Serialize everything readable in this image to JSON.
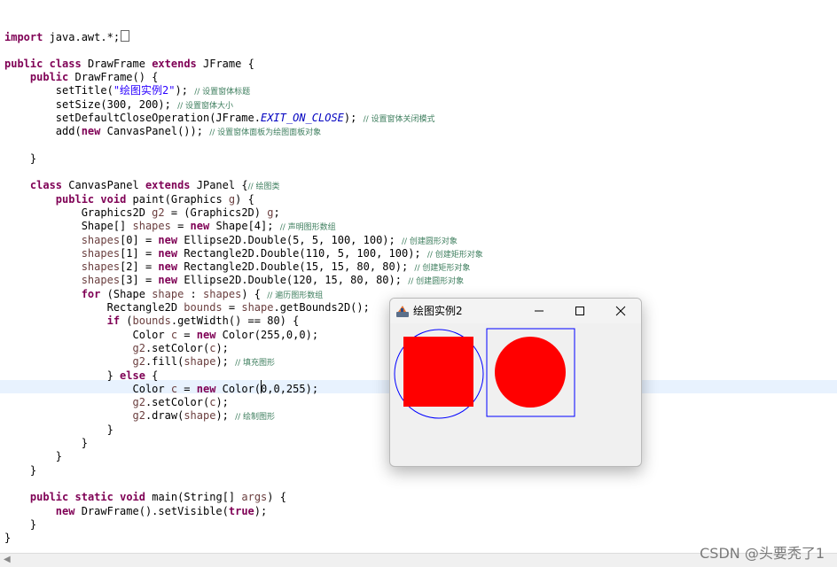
{
  "editor": {
    "lines": [
      {
        "parts": [
          {
            "t": "import",
            "c": "kw"
          },
          {
            "t": " java.awt.*;"
          }
        ],
        "glyph": true
      },
      {
        "parts": []
      },
      {
        "parts": [
          {
            "t": "public",
            "c": "kw"
          },
          {
            "t": " "
          },
          {
            "t": "class",
            "c": "kw"
          },
          {
            "t": " DrawFrame "
          },
          {
            "t": "extends",
            "c": "kw"
          },
          {
            "t": " JFrame {"
          }
        ]
      },
      {
        "parts": [
          {
            "t": "    "
          },
          {
            "t": "public",
            "c": "kw"
          },
          {
            "t": " DrawFrame() {"
          }
        ]
      },
      {
        "parts": [
          {
            "t": "        setTitle("
          },
          {
            "t": "\"绘图实例2\"",
            "c": "str"
          },
          {
            "t": "); "
          },
          {
            "t": "// 设置窗体标题",
            "c": "cm"
          }
        ]
      },
      {
        "parts": [
          {
            "t": "        setSize(300, 200); "
          },
          {
            "t": "// 设置窗体大小",
            "c": "cm"
          }
        ]
      },
      {
        "parts": [
          {
            "t": "        setDefaultCloseOperation(JFrame."
          },
          {
            "t": "EXIT_ON_CLOSE",
            "c": "fld"
          },
          {
            "t": "); "
          },
          {
            "t": "// 设置窗体关闭模式",
            "c": "cm"
          }
        ]
      },
      {
        "parts": [
          {
            "t": "        add("
          },
          {
            "t": "new",
            "c": "kw"
          },
          {
            "t": " CanvasPanel()); "
          },
          {
            "t": "// 设置窗体面板为绘图面板对象",
            "c": "cm"
          }
        ]
      },
      {
        "parts": []
      },
      {
        "parts": [
          {
            "t": "    }"
          }
        ]
      },
      {
        "parts": []
      },
      {
        "parts": [
          {
            "t": "    "
          },
          {
            "t": "class",
            "c": "kw"
          },
          {
            "t": " CanvasPanel "
          },
          {
            "t": "extends",
            "c": "kw"
          },
          {
            "t": " JPanel {"
          },
          {
            "t": "// 绘图类",
            "c": "cm"
          }
        ]
      },
      {
        "parts": [
          {
            "t": "        "
          },
          {
            "t": "public",
            "c": "kw"
          },
          {
            "t": " "
          },
          {
            "t": "void",
            "c": "kw"
          },
          {
            "t": " paint(Graphics "
          },
          {
            "t": "g",
            "c": "var"
          },
          {
            "t": ") {"
          }
        ]
      },
      {
        "parts": [
          {
            "t": "            Graphics2D "
          },
          {
            "t": "g2",
            "c": "var"
          },
          {
            "t": " = (Graphics2D) "
          },
          {
            "t": "g",
            "c": "var"
          },
          {
            "t": ";"
          }
        ]
      },
      {
        "parts": [
          {
            "t": "            Shape[] "
          },
          {
            "t": "shapes",
            "c": "var"
          },
          {
            "t": " = "
          },
          {
            "t": "new",
            "c": "kw"
          },
          {
            "t": " Shape[4]; "
          },
          {
            "t": "// 声明图形数组",
            "c": "cm"
          }
        ]
      },
      {
        "parts": [
          {
            "t": "            "
          },
          {
            "t": "shapes",
            "c": "var"
          },
          {
            "t": "[0] = "
          },
          {
            "t": "new",
            "c": "kw"
          },
          {
            "t": " Ellipse2D.Double(5, 5, 100, 100); "
          },
          {
            "t": "// 创建圆形对象",
            "c": "cm"
          }
        ]
      },
      {
        "parts": [
          {
            "t": "            "
          },
          {
            "t": "shapes",
            "c": "var"
          },
          {
            "t": "[1] = "
          },
          {
            "t": "new",
            "c": "kw"
          },
          {
            "t": " Rectangle2D.Double(110, 5, 100, 100); "
          },
          {
            "t": "// 创建矩形对象",
            "c": "cm"
          }
        ]
      },
      {
        "parts": [
          {
            "t": "            "
          },
          {
            "t": "shapes",
            "c": "var"
          },
          {
            "t": "[2] = "
          },
          {
            "t": "new",
            "c": "kw"
          },
          {
            "t": " Rectangle2D.Double(15, 15, 80, 80); "
          },
          {
            "t": "// 创建矩形对象",
            "c": "cm"
          }
        ]
      },
      {
        "parts": [
          {
            "t": "            "
          },
          {
            "t": "shapes",
            "c": "var"
          },
          {
            "t": "[3] = "
          },
          {
            "t": "new",
            "c": "kw"
          },
          {
            "t": " Ellipse2D.Double(120, 15, 80, 80); "
          },
          {
            "t": "// 创建圆形对象",
            "c": "cm"
          }
        ]
      },
      {
        "parts": [
          {
            "t": "            "
          },
          {
            "t": "for",
            "c": "kw"
          },
          {
            "t": " (Shape "
          },
          {
            "t": "shape",
            "c": "var"
          },
          {
            "t": " : "
          },
          {
            "t": "shapes",
            "c": "var"
          },
          {
            "t": ") { "
          },
          {
            "t": "// 遍历图形数组",
            "c": "cm"
          }
        ]
      },
      {
        "parts": [
          {
            "t": "                Rectangle2D "
          },
          {
            "t": "bounds",
            "c": "var"
          },
          {
            "t": " = "
          },
          {
            "t": "shape",
            "c": "var"
          },
          {
            "t": ".getBounds2D();"
          }
        ]
      },
      {
        "parts": [
          {
            "t": "                "
          },
          {
            "t": "if",
            "c": "kw"
          },
          {
            "t": " ("
          },
          {
            "t": "bounds",
            "c": "var"
          },
          {
            "t": ".getWidth() == 80) {"
          }
        ]
      },
      {
        "parts": [
          {
            "t": "                    Color "
          },
          {
            "t": "c",
            "c": "var"
          },
          {
            "t": " = "
          },
          {
            "t": "new",
            "c": "kw"
          },
          {
            "t": " Color(255,0,0);"
          }
        ]
      },
      {
        "parts": [
          {
            "t": "                    "
          },
          {
            "t": "g2",
            "c": "var"
          },
          {
            "t": ".setColor("
          },
          {
            "t": "c",
            "c": "var"
          },
          {
            "t": ");"
          }
        ]
      },
      {
        "parts": [
          {
            "t": "                    "
          },
          {
            "t": "g2",
            "c": "var"
          },
          {
            "t": ".fill("
          },
          {
            "t": "shape",
            "c": "var"
          },
          {
            "t": "); "
          },
          {
            "t": "// 填充图形",
            "c": "cm"
          }
        ]
      },
      {
        "parts": [
          {
            "t": "                } "
          },
          {
            "t": "else",
            "c": "kw"
          },
          {
            "t": " {"
          }
        ]
      },
      {
        "parts": [
          {
            "t": "                    Color "
          },
          {
            "t": "c",
            "c": "var"
          },
          {
            "t": " = "
          },
          {
            "t": "new",
            "c": "kw"
          },
          {
            "t": " Color(0,0,255);"
          }
        ]
      },
      {
        "parts": [
          {
            "t": "                    "
          },
          {
            "t": "g2",
            "c": "var"
          },
          {
            "t": ".setColor("
          },
          {
            "t": "c",
            "c": "var"
          },
          {
            "t": ");"
          }
        ]
      },
      {
        "parts": [
          {
            "t": "                    "
          },
          {
            "t": "g2",
            "c": "var"
          },
          {
            "t": ".draw("
          },
          {
            "t": "shape",
            "c": "var"
          },
          {
            "t": "); "
          },
          {
            "t": "// 绘制图形",
            "c": "cm"
          }
        ]
      },
      {
        "parts": [
          {
            "t": "                }"
          }
        ]
      },
      {
        "parts": [
          {
            "t": "            }"
          }
        ]
      },
      {
        "parts": [
          {
            "t": "        }"
          }
        ]
      },
      {
        "parts": [
          {
            "t": "    }"
          }
        ]
      },
      {
        "parts": []
      },
      {
        "parts": [
          {
            "t": "    "
          },
          {
            "t": "public",
            "c": "kw"
          },
          {
            "t": " "
          },
          {
            "t": "static",
            "c": "kw"
          },
          {
            "t": " "
          },
          {
            "t": "void",
            "c": "kw"
          },
          {
            "t": " main(String[] "
          },
          {
            "t": "args",
            "c": "var"
          },
          {
            "t": ") {"
          }
        ]
      },
      {
        "parts": [
          {
            "t": "        "
          },
          {
            "t": "new",
            "c": "kw"
          },
          {
            "t": " DrawFrame().setVisible("
          },
          {
            "t": "true",
            "c": "kw"
          },
          {
            "t": ");"
          }
        ]
      },
      {
        "parts": [
          {
            "t": "    }"
          }
        ]
      },
      {
        "parts": [
          {
            "t": "}"
          }
        ]
      }
    ]
  },
  "window": {
    "title": "绘图实例2",
    "icons": {
      "app": "java-app-icon",
      "minimize": "minimize-icon",
      "maximize": "maximize-icon",
      "close": "close-icon"
    }
  },
  "colors": {
    "fill": "#ff0000",
    "stroke": "#0000ff",
    "highlight": "#e8f2fe"
  },
  "watermark": "CSDN @头要秃了1"
}
